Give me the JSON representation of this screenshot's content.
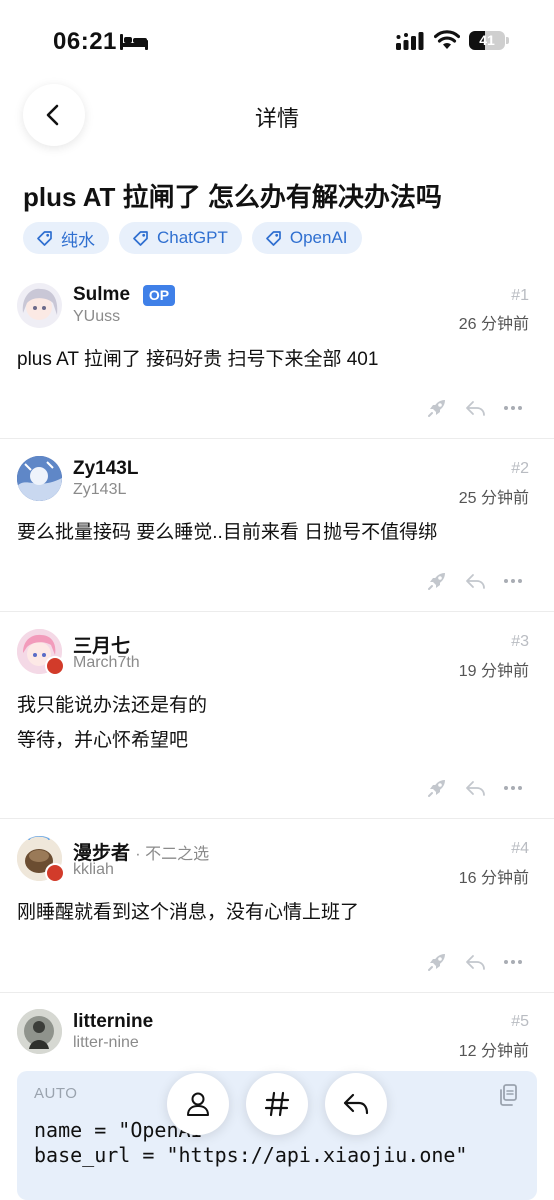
{
  "status_bar": {
    "time": "06:21",
    "battery": "41"
  },
  "header": {
    "title": "详情"
  },
  "post": {
    "title": "plus AT 拉闸了 怎么办有解决办法吗",
    "tags": [
      {
        "label": "纯水"
      },
      {
        "label": "ChatGPT"
      },
      {
        "label": "OpenAI"
      }
    ]
  },
  "replies": [
    {
      "name": "Sulme",
      "username": "YUuss",
      "badge": "OP",
      "floor": "#1",
      "time": "26 分钟前",
      "lines": [
        "plus AT 拉闸了 接码好贵 扫号下来全部 401"
      ]
    },
    {
      "name": "Zy143L",
      "username": "Zy143L",
      "floor": "#2",
      "time": "25 分钟前",
      "lines": [
        "要么批量接码 要么睡觉..目前来看 日抛号不值得绑"
      ]
    },
    {
      "name": "三月七",
      "username": "March7th",
      "floor": "#3",
      "time": "19 分钟前",
      "lines": [
        "我只能说办法还是有的",
        "等待，并心怀希望吧"
      ]
    },
    {
      "name": "漫步者",
      "flair": "· 不二之选",
      "username": "kkliah",
      "floor": "#4",
      "time": "16 分钟前",
      "lines": [
        "刚睡醒就看到这个消息，没有心情上班了"
      ]
    },
    {
      "name": "litternine",
      "username": "litter-nine",
      "floor": "#5",
      "time": "12 分钟前",
      "code": {
        "lang": "AUTO",
        "lines": [
          "name = \"OpenAI\"",
          "base_url = \"https://api.xiaojiu.one\""
        ]
      }
    }
  ],
  "icons": {
    "back": "chevron-left-icon",
    "tag": "tag-icon",
    "boost": "rocket-icon",
    "reply": "reply-icon",
    "more": "more-dots-icon",
    "copy": "copy-icon",
    "profile": "user-icon",
    "topics": "hash-icon"
  },
  "colors": {
    "accent": "#3f80e8",
    "tag_bg": "#e8f0fb",
    "tag_text": "#2f6fd0",
    "code_bg": "#e7effa"
  }
}
